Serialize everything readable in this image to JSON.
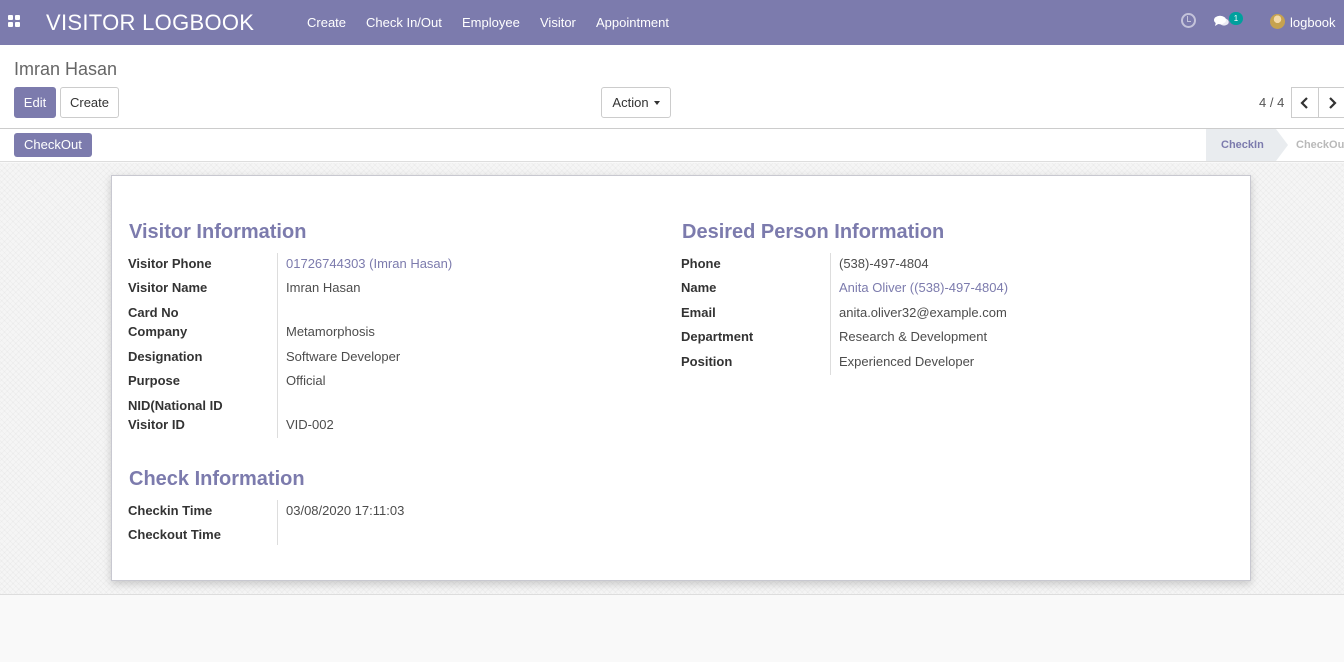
{
  "navbar": {
    "brand": "VISITOR LOGBOOK",
    "menu": [
      "Create",
      "Check In/Out",
      "Employee",
      "Visitor",
      "Appointment"
    ],
    "chat_count": "1",
    "user": "logbook",
    "color": "#7c7bad"
  },
  "control_panel": {
    "title": "Imran Hasan",
    "edit_label": "Edit",
    "create_label": "Create",
    "action_label": "Action",
    "pager": "4 / 4"
  },
  "statusbar": {
    "checkout_label": "CheckOut",
    "stages": [
      "CheckIn",
      "CheckOut"
    ],
    "active_stage": "CheckIn"
  },
  "visitor_info": {
    "title": "Visitor Information",
    "fields": [
      {
        "label": "Visitor Phone",
        "value": "01726744303 (Imran Hasan)",
        "link": true
      },
      {
        "label": "Visitor Name",
        "value": "Imran Hasan"
      },
      {
        "label": "Card No",
        "value": ""
      },
      {
        "label": "Company",
        "value": "Metamorphosis"
      },
      {
        "label": "Designation",
        "value": "Software Developer"
      },
      {
        "label": "Purpose",
        "value": "Official"
      },
      {
        "label": "NID(National ID",
        "value": ""
      },
      {
        "label": "Visitor ID",
        "value": "VID-002"
      }
    ]
  },
  "desired_person": {
    "title": "Desired Person Information",
    "fields": [
      {
        "label": "Phone",
        "value": "(538)-497-4804"
      },
      {
        "label": "Name",
        "value": "Anita Oliver ((538)-497-4804)",
        "link": true
      },
      {
        "label": "Email",
        "value": "anita.oliver32@example.com"
      },
      {
        "label": "Department",
        "value": "Research & Development"
      },
      {
        "label": "Position",
        "value": "Experienced Developer"
      }
    ]
  },
  "check_info": {
    "title": "Check Information",
    "fields": [
      {
        "label": "Checkin Time",
        "value": "03/08/2020 17:11:03"
      },
      {
        "label": "Checkout Time",
        "value": ""
      }
    ]
  }
}
